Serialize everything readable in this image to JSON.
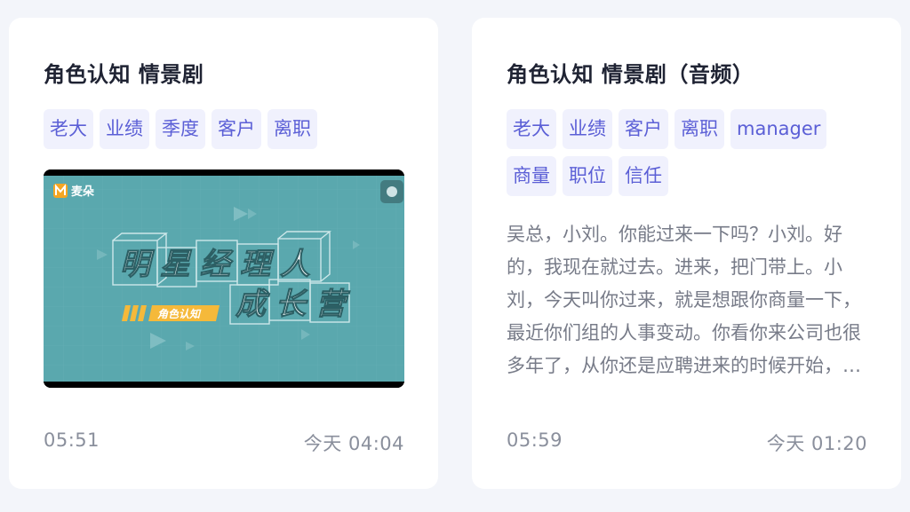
{
  "cards": [
    {
      "title": "角色认知 情景剧",
      "tags": [
        "老大",
        "业绩",
        "季度",
        "客户",
        "离职"
      ],
      "thumbnail": {
        "logo_text": "麦朵",
        "headline_1": "明星经理人",
        "headline_2": "成长营",
        "badge": "角色认知"
      },
      "duration": "05:51",
      "time": "今天 04:04"
    },
    {
      "title": "角色认知 情景剧（音频）",
      "tags": [
        "老大",
        "业绩",
        "客户",
        "离职",
        "manager",
        "商量",
        "职位",
        "信任"
      ],
      "transcript": "吴总，小刘。你能过来一下吗？小刘。好的，我现在就过去。进来，把门带上。小刘，今天叫你过来，就是想跟你商量一下，最近你们组的人事变动。你看你来公司也很多年了，从你还是应聘进来的时候开始，我就一直很看好你。",
      "duration": "05:59",
      "time": "今天 01:20"
    }
  ],
  "colors": {
    "background": "#f3f5fa",
    "card": "#ffffff",
    "tag_bg": "#f0f1fd",
    "tag_text": "#5b5fd6",
    "thumbnail_bg": "#5aa8ae",
    "badge": "#f5b93a"
  }
}
